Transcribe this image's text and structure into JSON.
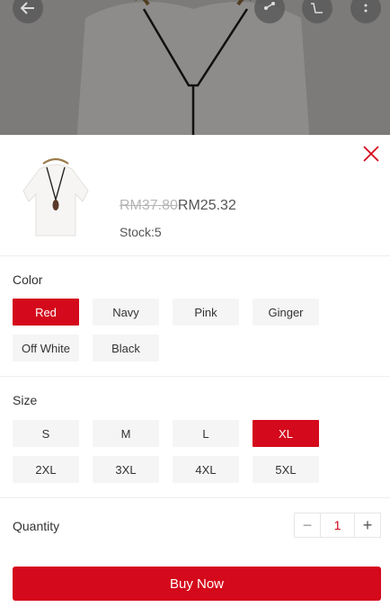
{
  "background": {
    "icons": [
      "back-arrow-icon",
      "share-icon",
      "cart-icon",
      "more-icon"
    ]
  },
  "product": {
    "thumbnail": "white-blouse-with-necklace",
    "price_original": "RM37.80",
    "price_current": "RM25.32",
    "stock_label": "Stock:5"
  },
  "color": {
    "title": "Color",
    "options": [
      "Red",
      "Navy",
      "Pink",
      "Ginger",
      "Off White",
      "Black"
    ],
    "selected": "Red"
  },
  "size": {
    "title": "Size",
    "options": [
      "S",
      "M",
      "L",
      "XL",
      "2XL",
      "3XL",
      "4XL",
      "5XL"
    ],
    "selected": "XL"
  },
  "quantity": {
    "label": "Quantity",
    "value": "1",
    "minus": "−",
    "plus": "+"
  },
  "actions": {
    "buy_now": "Buy Now"
  },
  "colors": {
    "accent": "#d4091b",
    "option_bg": "#f5f5f5"
  }
}
